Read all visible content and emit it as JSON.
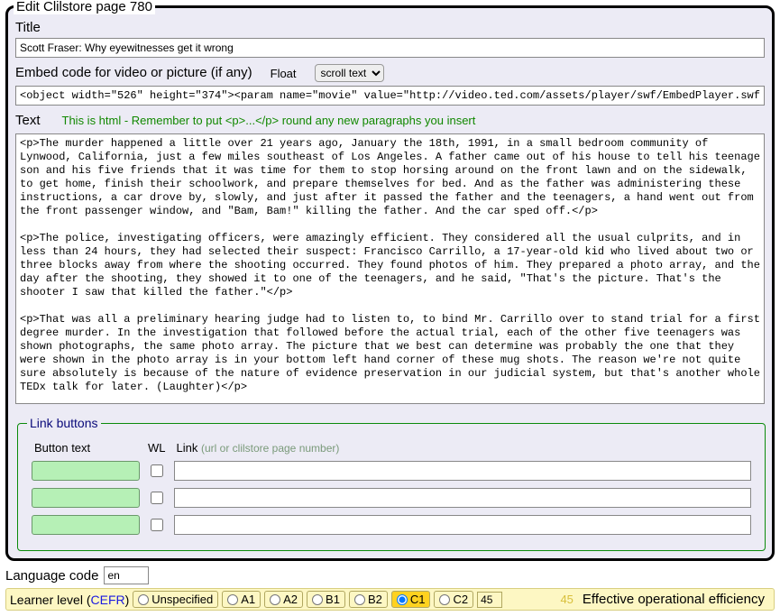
{
  "legend": "Edit Clilstore page 780",
  "title": {
    "label": "Title",
    "value": "Scott Fraser: Why eyewitnesses get it wrong"
  },
  "embed": {
    "label": "Embed code for video or picture (if any)",
    "float_label": "Float",
    "float_value": "scroll text",
    "value": "<object width=\"526\" height=\"374\"><param name=\"movie\" value=\"http://video.ted.com/assets/player/swf/EmbedPlayer.swf\"></param><param name=\"allowFullScreen\" value=\"true\" />"
  },
  "text": {
    "label": "Text",
    "hint": "This is html - Remember to put <p>...</p> round any new paragraphs you insert",
    "value": "<p>The murder happened a little over 21 years ago, January the 18th, 1991, in a small bedroom community of Lynwood, California, just a few miles southeast of Los Angeles. A father came out of his house to tell his teenage son and his five friends that it was time for them to stop horsing around on the front lawn and on the sidewalk, to get home, finish their schoolwork, and prepare themselves for bed. And as the father was administering these instructions, a car drove by, slowly, and just after it passed the father and the teenagers, a hand went out from the front passenger window, and \"Bam, Bam!\" killing the father. And the car sped off.</p>\n\n<p>The police, investigating officers, were amazingly efficient. They considered all the usual culprits, and in less than 24 hours, they had selected their suspect: Francisco Carrillo, a 17-year-old kid who lived about two or three blocks away from where the shooting occurred. They found photos of him. They prepared a photo array, and the day after the shooting, they showed it to one of the teenagers, and he said, \"That's the picture. That's the shooter I saw that killed the father.\"</p>\n\n<p>That was all a preliminary hearing judge had to listen to, to bind Mr. Carrillo over to stand trial for a first degree murder. In the investigation that followed before the actual trial, each of the other five teenagers was shown photographs, the same photo array. The picture that we best can determine was probably the one that they were shown in the photo array is in your bottom left hand corner of these mug shots. The reason we're not quite sure absolutely is because of the nature of evidence preservation in our judicial system, but that's another whole TEDx talk for later. (Laughter)</p>\n\n<p>So at the actual trial, all six of the teenagers testified, and indicated the identifications they had made in the photo array. He was convicted. He was sentenced to life imprisonment, and transported to Folsom Prison.</p>\n\n<p>So what's wrong? Straightforward, fair trial, full investigation. Oh yes, no gun was ever found. No vehicle was ever identified as being the one in which the shooter had extended his arm, and no person was ever charged with being the driver of the shooter's vehicle. And Mr. Carrillo's alibi? Which of those parents here in the room might not lie concerning the whereabouts of your son or daughter in an investigation of a killing?</p>\n\n<p>Sent to prison, adamantly insisting on his innocence, which he has consistently for 21 years.</p>\n\n<p>So what's the problem? The problems actually for this kind of case come manyfold from decades of scientific research"
  },
  "link_buttons": {
    "legend": "Link buttons",
    "headers": {
      "btn": "Button text",
      "wl": "WL",
      "link": "Link",
      "hint": "(url or clilstore page number)"
    },
    "rows": [
      {
        "btn": "",
        "wl": false,
        "link": ""
      },
      {
        "btn": "",
        "wl": false,
        "link": ""
      },
      {
        "btn": "",
        "wl": false,
        "link": ""
      }
    ]
  },
  "language": {
    "label": "Language code",
    "value": "en"
  },
  "level": {
    "label_pre": "Learner level (",
    "cefr": "CEFR",
    "label_post": ")",
    "options": {
      "unspec": "Unspecified",
      "a1": "A1",
      "a2": "A2",
      "b1": "B1",
      "b2": "B2",
      "c1": "C1",
      "c2": "C2"
    },
    "selected": "c1",
    "value": "45",
    "echo": "45",
    "desc": "Effective operational efficiency"
  }
}
